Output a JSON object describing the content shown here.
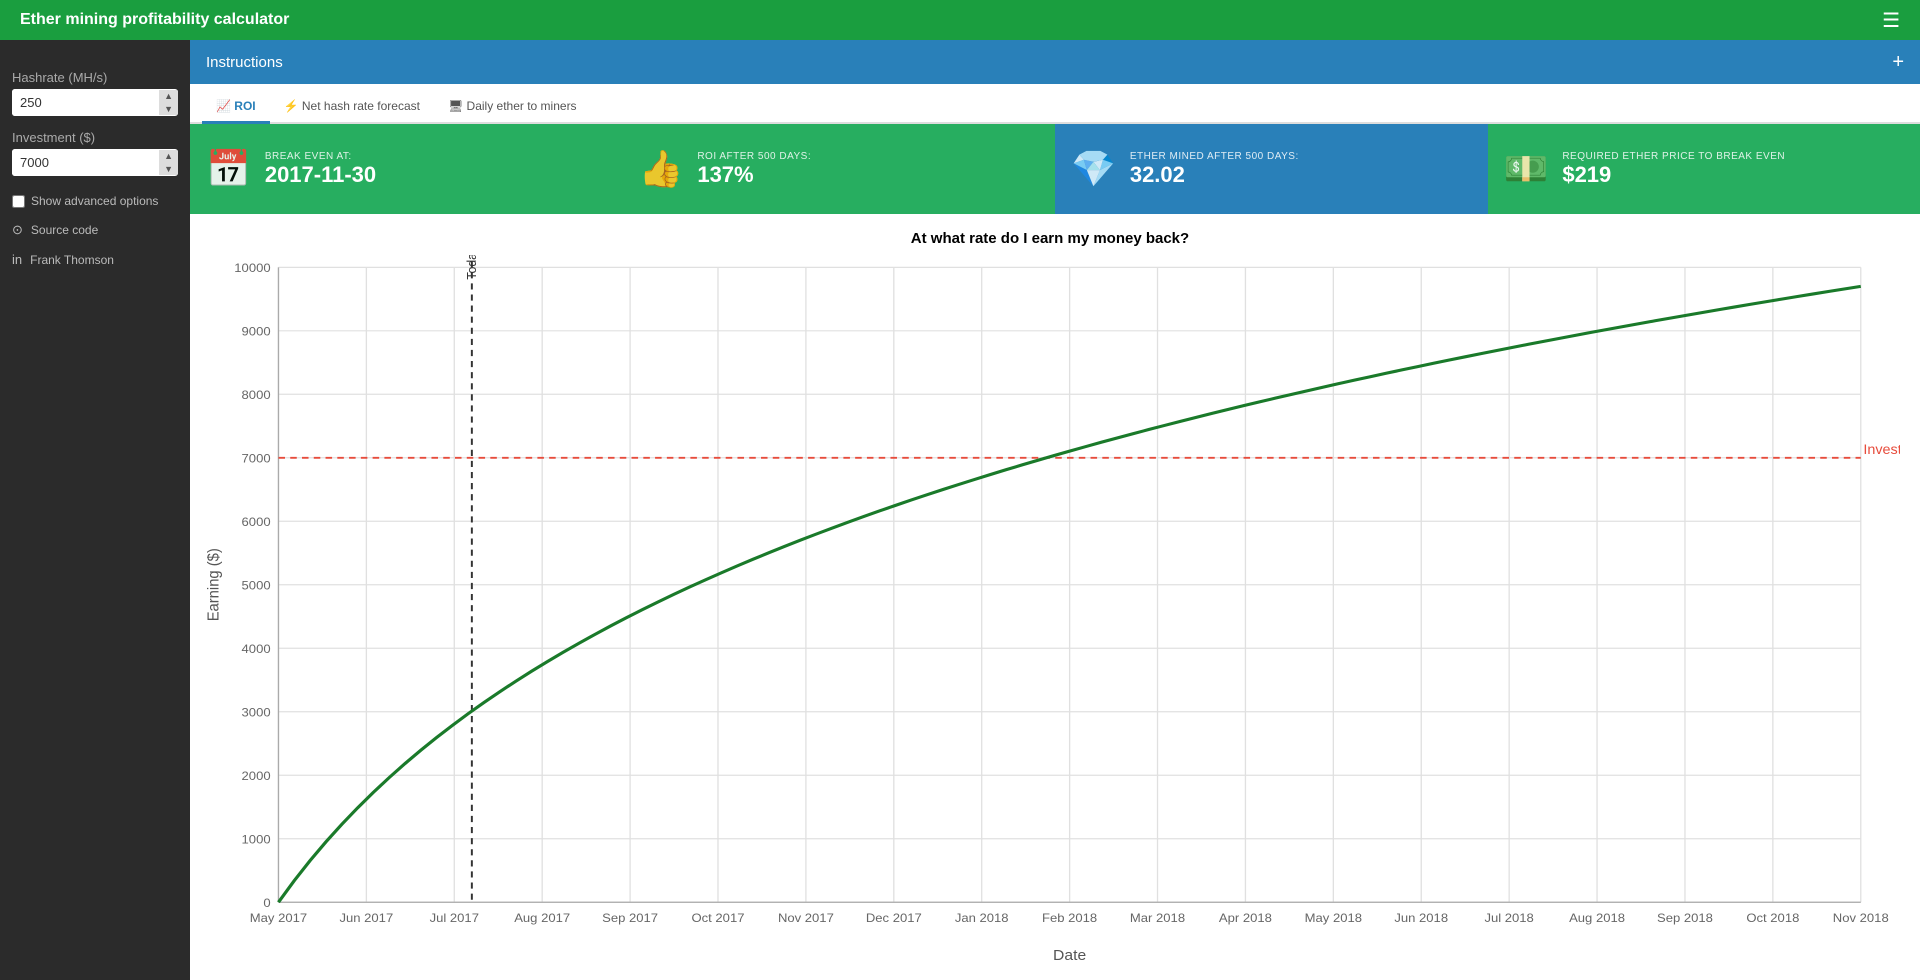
{
  "app": {
    "title": "Ether mining profitability calculator",
    "hamburger_icon": "☰"
  },
  "sidebar": {
    "hashrate_label": "Hashrate (MH/s)",
    "hashrate_value": "250",
    "investment_label": "Investment ($)",
    "investment_value": "7000",
    "show_advanced_label": "Show advanced options",
    "source_code_label": "Source code",
    "author_label": "Frank Thomson"
  },
  "instructions": {
    "title": "Instructions",
    "plus_icon": "+"
  },
  "tabs": [
    {
      "id": "roi",
      "label": "ROI",
      "active": true
    },
    {
      "id": "nethash",
      "label": "Net hash rate forecast",
      "active": false
    },
    {
      "id": "daily",
      "label": "Daily ether to miners",
      "active": false
    }
  ],
  "stat_cards": [
    {
      "color": "green",
      "label": "BREAK EVEN AT:",
      "value": "2017-11-30",
      "icon": "📅"
    },
    {
      "color": "green",
      "label": "ROI AFTER 500 DAYS:",
      "value": "137%",
      "icon": "👍"
    },
    {
      "color": "blue",
      "label": "ETHER MINED AFTER 500 DAYS:",
      "value": "32.02",
      "icon": "💎"
    },
    {
      "color": "green",
      "label": "REQUIRED ETHER PRICE TO BREAK EVEN",
      "value": "$219",
      "icon": "💵"
    }
  ],
  "chart": {
    "title": "At what rate do I earn my money back?",
    "y_axis_label": "Earning ($)",
    "x_axis_label": "Date",
    "investment_line_label": "Investment",
    "today_label": "Today",
    "x_ticks": [
      "May 2017",
      "Jun 2017",
      "Jul 2017",
      "Aug 2017",
      "Sep 2017",
      "Oct 2017",
      "Nov 2017",
      "Dec 2017",
      "Jan 2018",
      "Feb 2018",
      "Mar 2018",
      "Apr 2018",
      "May 2018",
      "Jun 2018",
      "Jul 2018",
      "Aug 2018",
      "Sep 2018",
      "Oct 2018",
      "Nov 2018"
    ],
    "y_ticks": [
      0,
      1000,
      2000,
      3000,
      4000,
      5000,
      6000,
      7000,
      8000,
      9000,
      10000
    ],
    "investment_value": 7000,
    "y_max": 10000
  }
}
